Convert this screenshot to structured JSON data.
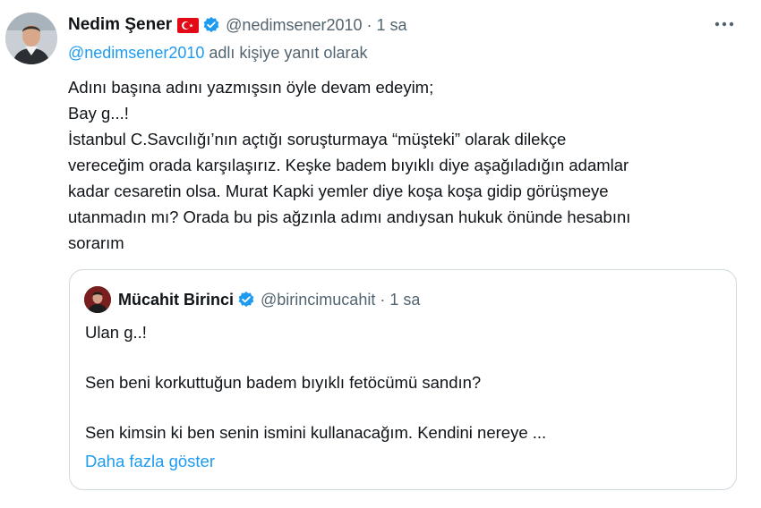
{
  "author": {
    "name": "Nedim Şener",
    "handle": "@nedimsener2010",
    "separator": "·",
    "time": "1 sa",
    "flag_icon": "turkey-flag-icon",
    "verified_icon": "verified-badge-icon"
  },
  "more_icon": "more-options-icon",
  "reply_context": {
    "handle": "@nedimsener2010",
    "suffix": " adlı kişiye yanıt olarak"
  },
  "tweet_lines": [
    "Adını başına adını yazmışsın öyle devam edeyim;",
    "Bay g...!",
    "İstanbul C.Savcılığı’nın açtığı soruşturmaya “müşteki” olarak dilekçe",
    "vereceğim orada karşılaşırız. Keşke badem bıyıklı diye aşağıladığın adamlar",
    "kadar cesaretin olsa. Murat Kapki yemler diye koşa koşa gidip görüşmeye",
    "utanmadın mı? Orada bu pis ağzınla adımı andıysan hukuk önünde hesabını",
    "sorarım"
  ],
  "quote": {
    "name": "Mücahit Birinci",
    "handle": "@birincimucahit",
    "separator": "·",
    "time": "1 sa",
    "lines": [
      "Ulan g..!",
      "Sen beni korkuttuğun badem bıyıklı fetöcümü sandın?",
      "Sen kimsin ki ben senin ismini kullanacağım. Kendini nereye ..."
    ],
    "show_more": "Daha fazla göster"
  },
  "colors": {
    "text": "#0f1419",
    "secondary": "#536471",
    "link": "#1d9bf0",
    "border": "#cfd9de",
    "flag_red": "#e30a17"
  }
}
